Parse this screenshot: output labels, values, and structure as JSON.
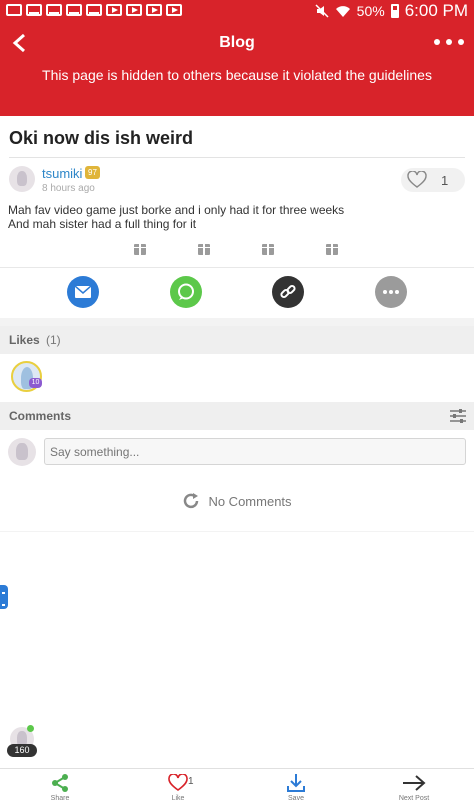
{
  "status_bar": {
    "battery": "50%",
    "time": "6:00 PM"
  },
  "header": {
    "title": "Blog",
    "notice": "This page is hidden to others because it violated the guidelines",
    "color": "#d8232a"
  },
  "post": {
    "title": "Oki now dis ish weird",
    "author": "tsumiki",
    "author_badge": "97",
    "time": "8 hours ago",
    "like_count": "1",
    "body_line1": "Mah fav video game just borke and i only had it for three weeks",
    "body_line2": "And mah sister had a full thing for it"
  },
  "share_buttons": [
    {
      "name": "email",
      "color": "#2c7bd6"
    },
    {
      "name": "chat",
      "color": "#5cc84a"
    },
    {
      "name": "link",
      "color": "#333333"
    },
    {
      "name": "more",
      "color": "#9b9b9b"
    }
  ],
  "likes": {
    "label": "Likes",
    "count": "(1)",
    "liker_level": "10"
  },
  "comments": {
    "label": "Comments",
    "placeholder": "Say something...",
    "empty_text": "No Comments"
  },
  "floating": {
    "count": "160"
  },
  "bottom_bar": {
    "share": "Share",
    "like": "Like",
    "like_count": "1",
    "save": "Save",
    "next": "Next Post"
  }
}
